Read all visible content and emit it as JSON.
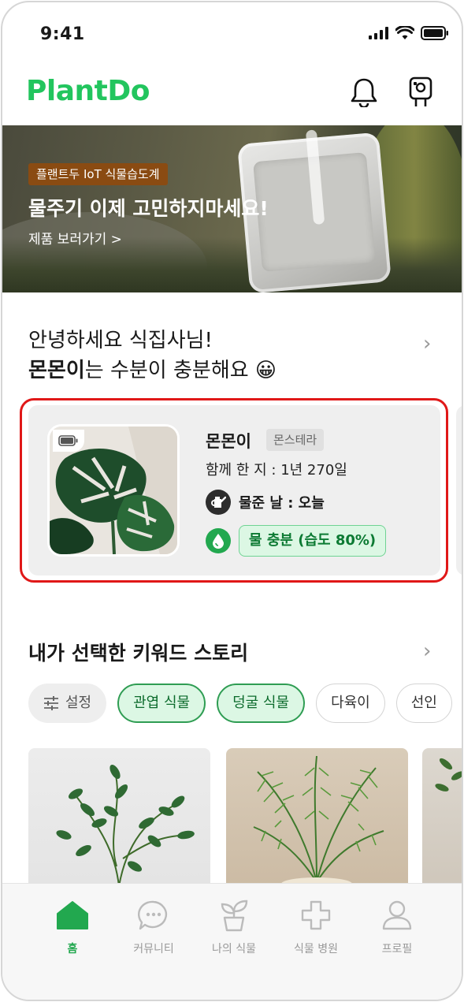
{
  "status_bar": {
    "time": "9:41"
  },
  "header": {
    "logo": "PlantDo",
    "bell_icon": "bell-icon",
    "device_icon": "iot-device-icon"
  },
  "banner": {
    "badge": "플랜트두 IoT 식물습도계",
    "title": "물주기 이제 고민하지마세요!",
    "link": "제품 보러가기 >"
  },
  "greeting": {
    "line1": "안녕하세요 식집사님!",
    "plant_name": "몬몬이",
    "status": "는 수분이 충분해요 😀",
    "arrow": "›"
  },
  "plant_card": {
    "name": "몬몬이",
    "species": "몬스테라",
    "together": "함께 한 지 : 1년 270일",
    "water_day": "물준 날 : 오늘",
    "moisture": "물 충분 (습도 80%)",
    "moisture_percent": 80
  },
  "keyword_section": {
    "title": "내가 선택한 키워드 스토리",
    "arrow": "›",
    "chips": [
      {
        "label": "설정",
        "type": "setting"
      },
      {
        "label": "관엽 식물",
        "type": "active"
      },
      {
        "label": "덩굴 식물",
        "type": "active"
      },
      {
        "label": "다육이",
        "type": "default"
      },
      {
        "label": "선인",
        "type": "default"
      }
    ]
  },
  "bottom_nav": {
    "items": [
      {
        "label": "홈",
        "icon": "home-icon",
        "active": true
      },
      {
        "label": "커뮤니티",
        "icon": "chat-icon",
        "active": false
      },
      {
        "label": "나의 식물",
        "icon": "plant-icon",
        "active": false
      },
      {
        "label": "식물 병원",
        "icon": "plus-icon",
        "active": false
      },
      {
        "label": "프로필",
        "icon": "profile-icon",
        "active": false
      }
    ]
  },
  "colors": {
    "brand_green": "#22c55e",
    "highlight_red": "#e01818",
    "active_chip_bg": "#dcf7e4"
  }
}
